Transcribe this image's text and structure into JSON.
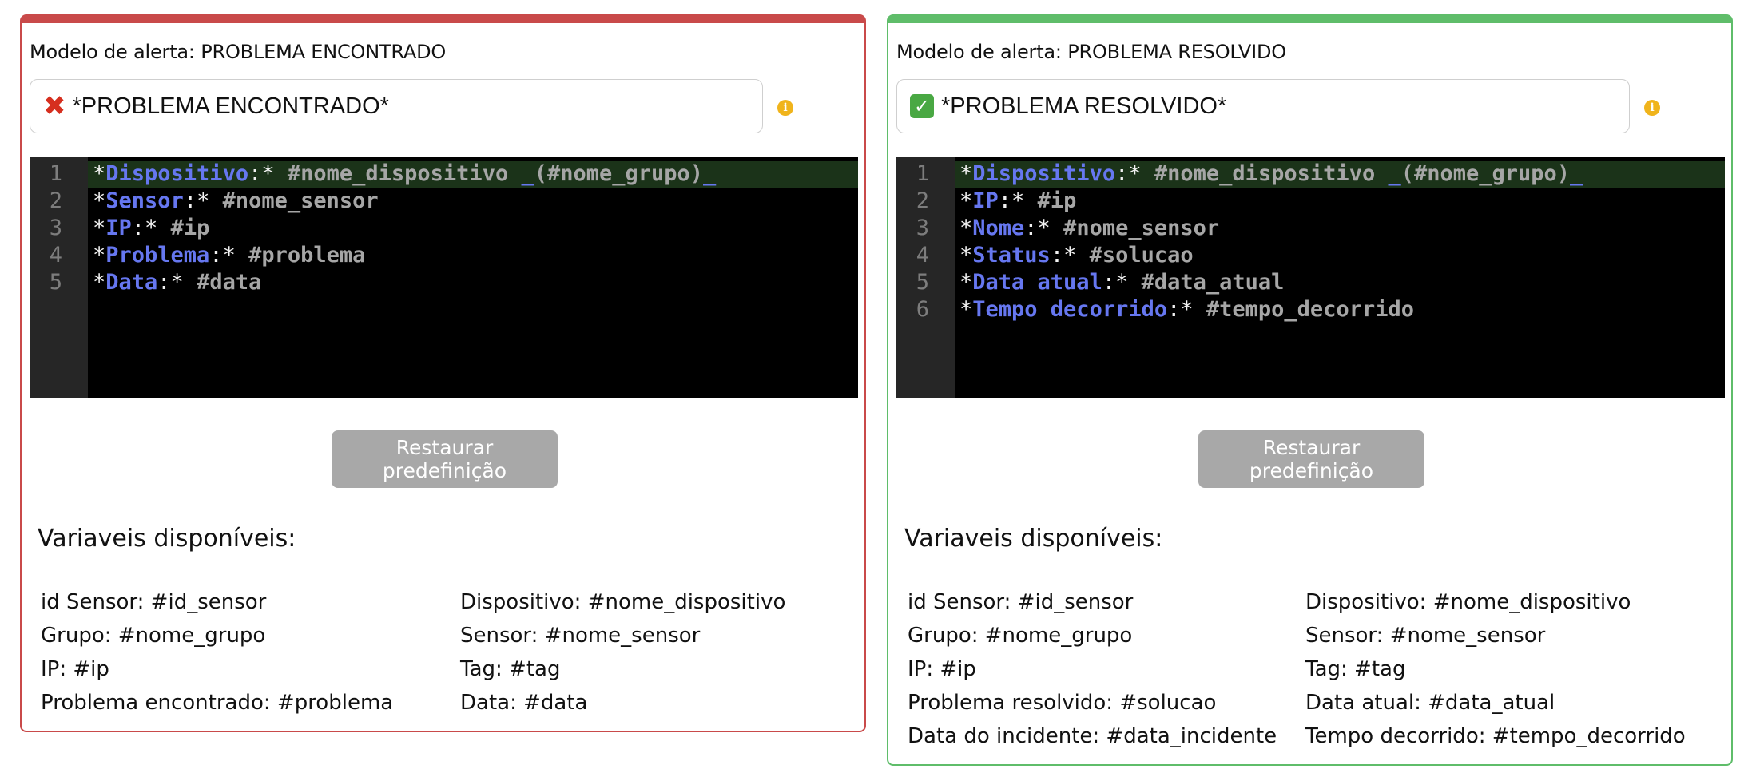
{
  "panels": {
    "problem": {
      "title": "Modelo de alerta: PROBLEMA ENCONTRADO",
      "subject": "*PROBLEMA ENCONTRADO*",
      "subject_icon": "cross-mark-icon",
      "accent_color": "#c94a4a",
      "line_numbers": [
        "1",
        "2",
        "3",
        "4",
        "5"
      ],
      "code_lines": [
        {
          "label": "Dispositivo",
          "value": "#nome_dispositivo",
          "group": "(#nome_grupo)"
        },
        {
          "label": "Sensor",
          "value": "#nome_sensor"
        },
        {
          "label": "IP",
          "value": "#ip"
        },
        {
          "label": "Problema",
          "value": "#problema"
        },
        {
          "label": "Data",
          "value": "#data"
        }
      ],
      "restore_label": "Restaurar predefinição",
      "vars_title": "Variaveis disponíveis:",
      "vars": [
        [
          "id Sensor: #id_sensor",
          "Dispositivo: #nome_dispositivo"
        ],
        [
          "Grupo: #nome_grupo",
          "Sensor: #nome_sensor"
        ],
        [
          "IP: #ip",
          "Tag: #tag"
        ],
        [
          "Problema encontrado: #problema",
          "Data: #data"
        ]
      ]
    },
    "resolved": {
      "title": "Modelo de alerta: PROBLEMA RESOLVIDO",
      "subject": "*PROBLEMA RESOLVIDO*",
      "subject_icon": "check-mark-icon",
      "accent_color": "#5fbd6a",
      "line_numbers": [
        "1",
        "2",
        "3",
        "4",
        "5",
        "6"
      ],
      "code_lines": [
        {
          "label": "Dispositivo",
          "value": "#nome_dispositivo",
          "group": "(#nome_grupo)"
        },
        {
          "label": "IP",
          "value": "#ip"
        },
        {
          "label": "Nome",
          "value": "#nome_sensor"
        },
        {
          "label": "Status",
          "value": "#solucao"
        },
        {
          "label": "Data atual",
          "value": "#data_atual"
        },
        {
          "label": "Tempo decorrido",
          "value": "#tempo_decorrido"
        }
      ],
      "restore_label": "Restaurar predefinição",
      "vars_title": "Variaveis disponíveis:",
      "vars": [
        [
          "id Sensor: #id_sensor",
          "Dispositivo: #nome_dispositivo"
        ],
        [
          "Grupo: #nome_grupo",
          "Sensor: #nome_sensor"
        ],
        [
          "IP: #ip",
          "Tag: #tag"
        ],
        [
          "Problema resolvido: #solucao",
          "Data atual: #data_atual"
        ],
        [
          "Data do incidente: #data_incidente",
          "Tempo decorrido: #tempo_decorrido"
        ]
      ]
    }
  }
}
